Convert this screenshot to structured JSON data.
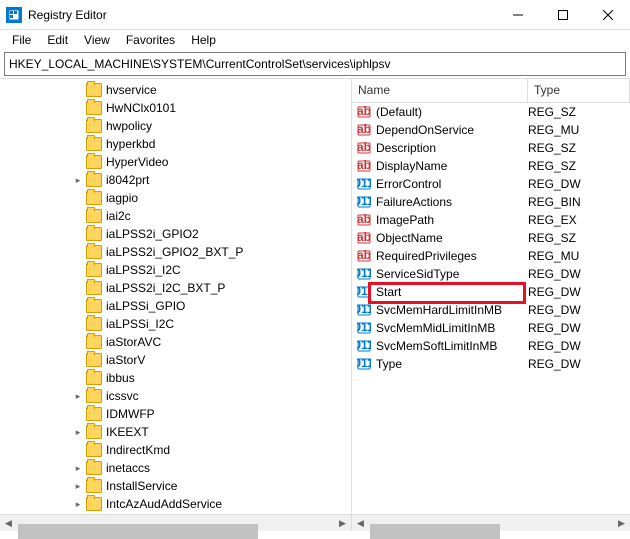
{
  "window": {
    "title": "Registry Editor"
  },
  "menu": {
    "items": [
      "File",
      "Edit",
      "View",
      "Favorites",
      "Help"
    ]
  },
  "address": {
    "path": "HKEY_LOCAL_MACHINE\\SYSTEM\\CurrentControlSet\\services\\iphlpsv"
  },
  "tree": {
    "items": [
      {
        "label": "hvservice",
        "expandable": false
      },
      {
        "label": "HwNClx0101",
        "expandable": false
      },
      {
        "label": "hwpolicy",
        "expandable": false
      },
      {
        "label": "hyperkbd",
        "expandable": false
      },
      {
        "label": "HyperVideo",
        "expandable": false
      },
      {
        "label": "i8042prt",
        "expandable": true
      },
      {
        "label": "iagpio",
        "expandable": false
      },
      {
        "label": "iai2c",
        "expandable": false
      },
      {
        "label": "iaLPSS2i_GPIO2",
        "expandable": false
      },
      {
        "label": "iaLPSS2i_GPIO2_BXT_P",
        "expandable": false
      },
      {
        "label": "iaLPSS2i_I2C",
        "expandable": false
      },
      {
        "label": "iaLPSS2i_I2C_BXT_P",
        "expandable": false
      },
      {
        "label": "iaLPSSi_GPIO",
        "expandable": false
      },
      {
        "label": "iaLPSSi_I2C",
        "expandable": false
      },
      {
        "label": "iaStorAVC",
        "expandable": false
      },
      {
        "label": "iaStorV",
        "expandable": false
      },
      {
        "label": "ibbus",
        "expandable": false
      },
      {
        "label": "icssvc",
        "expandable": true
      },
      {
        "label": "IDMWFP",
        "expandable": false
      },
      {
        "label": "IKEEXT",
        "expandable": true
      },
      {
        "label": "IndirectKmd",
        "expandable": false
      },
      {
        "label": "inetaccs",
        "expandable": true
      },
      {
        "label": "InstallService",
        "expandable": true
      },
      {
        "label": "IntcAzAudAddService",
        "expandable": true
      }
    ]
  },
  "values": {
    "header": {
      "name": "Name",
      "type": "Type"
    },
    "rows": [
      {
        "name": "(Default)",
        "type": "REG_SZ",
        "kind": "str"
      },
      {
        "name": "DependOnService",
        "type": "REG_MU",
        "kind": "str"
      },
      {
        "name": "Description",
        "type": "REG_SZ",
        "kind": "str"
      },
      {
        "name": "DisplayName",
        "type": "REG_SZ",
        "kind": "str"
      },
      {
        "name": "ErrorControl",
        "type": "REG_DW",
        "kind": "bin"
      },
      {
        "name": "FailureActions",
        "type": "REG_BIN",
        "kind": "bin"
      },
      {
        "name": "ImagePath",
        "type": "REG_EX",
        "kind": "str"
      },
      {
        "name": "ObjectName",
        "type": "REG_SZ",
        "kind": "str"
      },
      {
        "name": "RequiredPrivileges",
        "type": "REG_MU",
        "kind": "str"
      },
      {
        "name": "ServiceSidType",
        "type": "REG_DW",
        "kind": "bin"
      },
      {
        "name": "Start",
        "type": "REG_DW",
        "kind": "bin",
        "highlighted": true
      },
      {
        "name": "SvcMemHardLimitInMB",
        "type": "REG_DW",
        "kind": "bin"
      },
      {
        "name": "SvcMemMidLimitInMB",
        "type": "REG_DW",
        "kind": "bin"
      },
      {
        "name": "SvcMemSoftLimitInMB",
        "type": "REG_DW",
        "kind": "bin"
      },
      {
        "name": "Type",
        "type": "REG_DW",
        "kind": "bin"
      }
    ]
  }
}
